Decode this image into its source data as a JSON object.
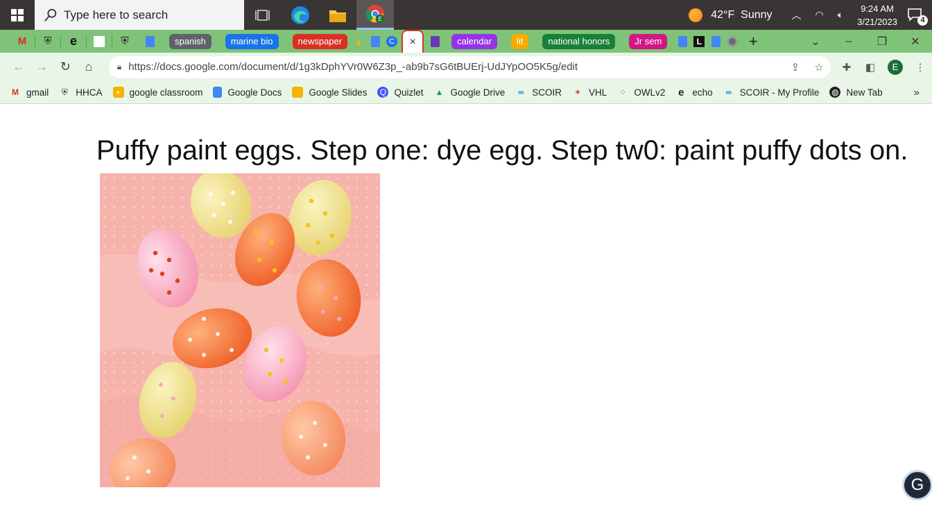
{
  "taskbar": {
    "search_placeholder": "Type here to search",
    "weather": {
      "temp": "42°F",
      "condition": "Sunny"
    },
    "clock": {
      "time": "9:24 AM",
      "date": "3/21/2023"
    },
    "notification_count": "4",
    "chrome_profile_letter": "E"
  },
  "tabs": {
    "groups": [
      {
        "label": "spanish",
        "color": "#5f6368"
      },
      {
        "label": "marine bio",
        "color": "#1a73e8"
      },
      {
        "label": "newspaper",
        "color": "#d93025"
      },
      {
        "label": "calendar",
        "color": "#9334e6"
      },
      {
        "label": "lit",
        "color": "#f9ab00"
      },
      {
        "label": "national honors",
        "color": "#188038"
      },
      {
        "label": "Jr sem",
        "color": "#d01884"
      }
    ],
    "active_close": "×",
    "new_tab": "+"
  },
  "toolbar": {
    "url": "https://docs.google.com/document/d/1g3kDphYVr0W6Z3p_-ab9b7sG6tBUErj-UdJYpOO5K5g/edit",
    "profile_letter": "E"
  },
  "bookmarks": [
    {
      "label": "gmail",
      "icon": "gmail-icon"
    },
    {
      "label": "HHCA",
      "icon": "shield-icon"
    },
    {
      "label": "google classroom",
      "icon": "classroom-icon"
    },
    {
      "label": "Google Docs",
      "icon": "docs-icon"
    },
    {
      "label": "Google Slides",
      "icon": "slides-icon"
    },
    {
      "label": "Quizlet",
      "icon": "quizlet-icon"
    },
    {
      "label": "Google Drive",
      "icon": "drive-icon"
    },
    {
      "label": "SCOIR",
      "icon": "scoir-icon"
    },
    {
      "label": "VHL",
      "icon": "vhl-icon"
    },
    {
      "label": "OWLv2",
      "icon": "owl-icon"
    },
    {
      "label": "echo",
      "icon": "echo-icon"
    },
    {
      "label": "SCOIR - My Profile",
      "icon": "scoir-icon"
    },
    {
      "label": "New Tab",
      "icon": "globe-icon"
    }
  ],
  "bookmarks_more": "»",
  "document": {
    "heading": "Puffy paint eggs. Step one: dye egg. Step tw0: paint puffy dots on."
  },
  "colors": {
    "tabstrip": "#7fc379",
    "toolbar": "#e9f5e6",
    "taskbar": "#3a3535"
  }
}
